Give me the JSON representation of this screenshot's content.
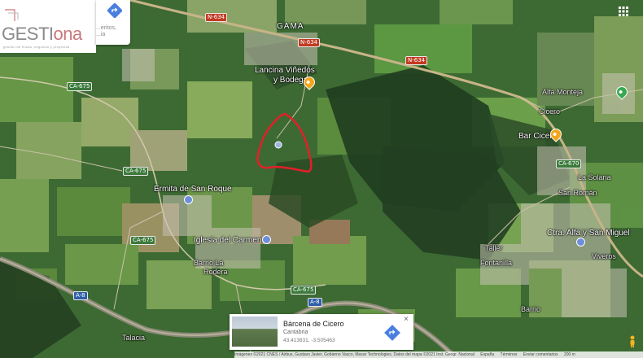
{
  "logo": {
    "brand": "GESTI",
    "brand_suffix": "ona",
    "tagline": "gestión de fincas, negocios y proyectos"
  },
  "search_card": {
    "snippet_line1": "...eritos,",
    "snippet_line2": "...ia"
  },
  "place_labels": {
    "gama": "GAMA",
    "lancina": "Lancina Viñedos",
    "lancina2": "y Bodegas",
    "bar_cicero": "Bar Cicero",
    "ermita": "Ermita de San Roque",
    "iglesia": "Iglesia del Carmen",
    "barrio": "Barrio La",
    "barrio2": "Rodera",
    "cicero": "Cicero",
    "alfa": "Alfa Monteja",
    "solana": "La Solana",
    "sanroman": "San Román",
    "taller": "Taller",
    "fontanilla": "Fontanilla",
    "viveros": "Viveros",
    "barrio_bajo": "Barrio",
    "falacia": "Talacia",
    "ctra": "Ctra. Alfa y San Miguel"
  },
  "road_shields": {
    "n634a": "N-634",
    "n634b": "N-634",
    "n634c": "N-634",
    "ca675a": "CA-675",
    "ca675b": "CA-675",
    "ca675c": "CA-675",
    "ca675d": "CA-675",
    "ca670": "CA-670",
    "a8a": "A-8",
    "a8b": "A-8"
  },
  "info_card": {
    "title": "Bárcena de Cicero",
    "region": "Cantabria",
    "coords": "43.413831, -3.505463",
    "close": "×"
  },
  "attribution": {
    "imagery": "Imágenes ©2021 CNES / Airbus, Gustavo Javier, Gobierno Vasco, Maxar Technologies, Datos del mapa ©2021 Inst. Geogr. Nacional",
    "country": "España",
    "terms": "Términos",
    "feedback": "Enviar comentarios",
    "scale": "200 m"
  },
  "colors": {
    "highlight": "#e2202a",
    "pin_orange": "#f2a51d",
    "pin_green": "#36a852",
    "dir_blue": "#4a7fe0"
  }
}
